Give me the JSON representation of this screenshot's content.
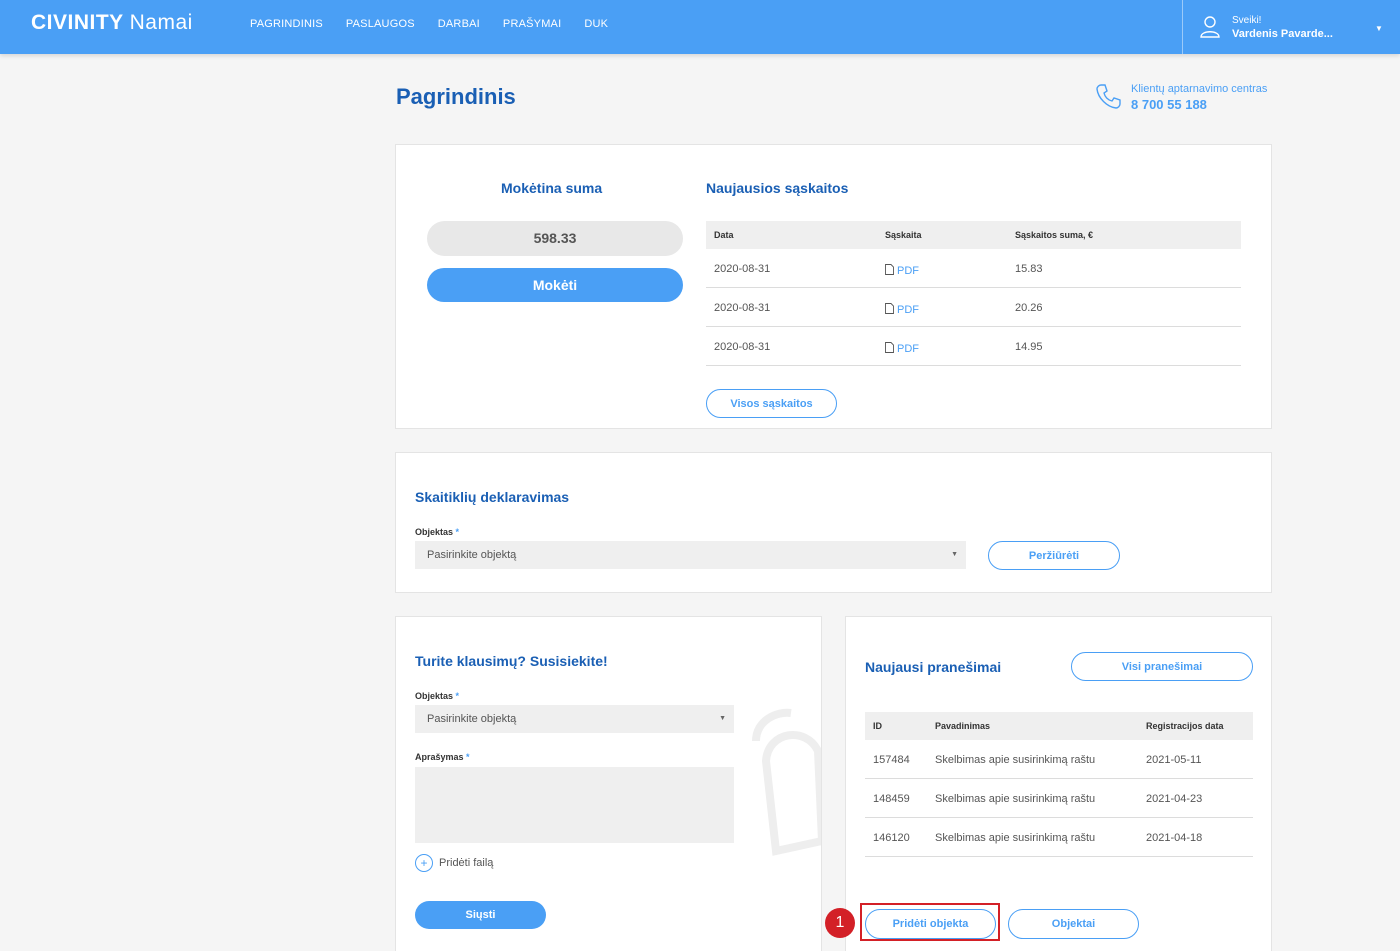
{
  "header": {
    "logo_main": "CIVINITY",
    "logo_suffix": "Namai",
    "nav": [
      "PAGRINDINIS",
      "PASLAUGOS",
      "DARBAI",
      "PRAŠYMAI",
      "DUK"
    ],
    "greeting": "Sveiki!",
    "user_name": "Vardenis Pavarde...",
    "user_icon": "user-icon"
  },
  "page": {
    "title": "Pagrindinis",
    "contact_label": "Klientų aptarnavimo centras",
    "contact_phone": "8 700 55 188"
  },
  "payment": {
    "title": "Mokėtina suma",
    "amount": "598.33",
    "pay_button": "Mokėti"
  },
  "invoices": {
    "title": "Naujausios sąskaitos",
    "columns": [
      "Data",
      "Sąskaita",
      "Sąskaitos suma, €"
    ],
    "rows": [
      {
        "date": "2020-08-31",
        "file": "PDF",
        "amount": "15.83"
      },
      {
        "date": "2020-08-31",
        "file": "PDF",
        "amount": "20.26"
      },
      {
        "date": "2020-08-31",
        "file": "PDF",
        "amount": "14.95"
      }
    ],
    "all_button": "Visos sąskaitos"
  },
  "meters": {
    "title": "Skaitiklių deklaravimas",
    "object_label": "Objektas",
    "required_mark": "*",
    "object_placeholder": "Pasirinkite objektą",
    "view_button": "Peržiūrėti"
  },
  "contact_form": {
    "title": "Turite klausimų? Susisiekite!",
    "object_label": "Objektas",
    "required_mark": "*",
    "object_placeholder": "Pasirinkite objektą",
    "description_label": "Aprašymas",
    "add_file": "Pridėti failą",
    "send_button": "Siųsti"
  },
  "messages": {
    "title": "Naujausi pranešimai",
    "all_button": "Visi pranešimai",
    "columns": [
      "ID",
      "Pavadinimas",
      "Registracijos data"
    ],
    "rows": [
      {
        "id": "157484",
        "name": "Skelbimas apie susirinkimą raštu",
        "date": "2021-05-11"
      },
      {
        "id": "148459",
        "name": "Skelbimas apie susirinkimą raštu",
        "date": "2021-04-23"
      },
      {
        "id": "146120",
        "name": "Skelbimas apie susirinkimą raštu",
        "date": "2021-04-18"
      }
    ],
    "add_object_button": "Pridėti objekta",
    "objects_button": "Objektai"
  },
  "annotation": {
    "step_number": "1",
    "highlight_color": "#d32027"
  },
  "colors": {
    "primary": "#4a9ff5",
    "title": "#1a5fb4"
  }
}
